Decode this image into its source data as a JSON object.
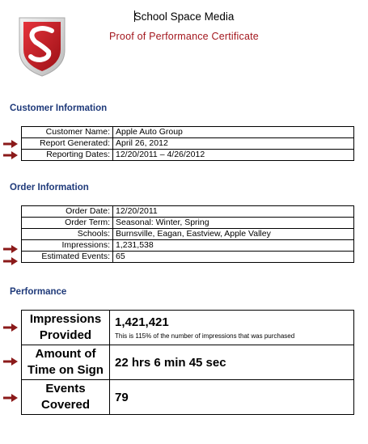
{
  "header": {
    "company": "School Space Media",
    "title": "Proof of Performance Certificate"
  },
  "colors": {
    "title": "#a3171e",
    "section_heading": "#1f3a7a",
    "arrow": "#8b1a1a",
    "logo_red": "#c8202a"
  },
  "customer": {
    "heading": "Customer Information",
    "rows": [
      {
        "label": "Customer Name:",
        "value": "Apple Auto Group"
      },
      {
        "label": "Report Generated:",
        "value": "April 26, 2012"
      },
      {
        "label": "Reporting Dates:",
        "value": "12/20/2011 – 4/26/2012"
      }
    ]
  },
  "order": {
    "heading": "Order Information",
    "rows": [
      {
        "label": "Order Date:",
        "value": "12/20/2011"
      },
      {
        "label": "Order Term:",
        "value": "Seasonal: Winter, Spring"
      },
      {
        "label": "Schools:",
        "value": "Burnsville, Eagan, Eastview, Apple Valley"
      },
      {
        "label": "Impressions:",
        "value": "1,231,538"
      },
      {
        "label": "Estimated Events:",
        "value": "65"
      }
    ]
  },
  "performance": {
    "heading": "Performance",
    "rows": [
      {
        "label_line1": "Impressions",
        "label_line2": "Provided",
        "value": "1,421,421",
        "note": "This is 115% of the number of impressions that was purchased"
      },
      {
        "label_line1": "Amount of",
        "label_line2": "Time on Sign",
        "value": "22 hrs 6 min 45 sec"
      },
      {
        "label_line1": "Events",
        "label_line2": "Covered",
        "value": "79"
      }
    ]
  }
}
